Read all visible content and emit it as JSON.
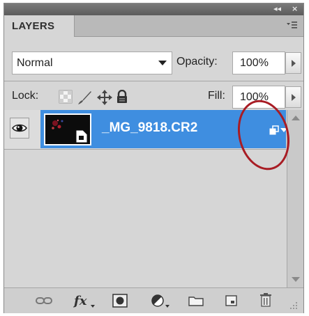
{
  "panel": {
    "tab_title": "LAYERS",
    "titlebar_controls": {
      "collapse_glyph": "◂◂",
      "close_glyph": "×"
    },
    "menu_icon": "panel-menu-icon"
  },
  "options": {
    "blend_mode": "Normal",
    "opacity_label": "Opacity:",
    "opacity_value": "100%",
    "lock_label": "Lock:",
    "fill_label": "Fill:",
    "fill_value": "100%"
  },
  "lock_icons": [
    "lock-transparent-pixels-icon",
    "lock-image-pixels-icon",
    "lock-position-icon",
    "lock-all-icon"
  ],
  "layers": [
    {
      "name": "_MG_9818.CR2",
      "visible": true,
      "selected": true,
      "type": "smart-object",
      "thumbnail_icon": "smart-object-thumbnail-icon",
      "badge_icon": "smart-object-badge-icon"
    }
  ],
  "bottom_icons": [
    "link-layers-icon",
    "layer-style-fx-icon",
    "add-mask-icon",
    "adjustment-layer-icon",
    "new-group-folder-icon",
    "new-layer-icon",
    "delete-trash-icon"
  ],
  "colors": {
    "selection": "#3f8ee0",
    "annotation_circle": "#a81c24",
    "panel_bg": "#d6d6d6"
  }
}
